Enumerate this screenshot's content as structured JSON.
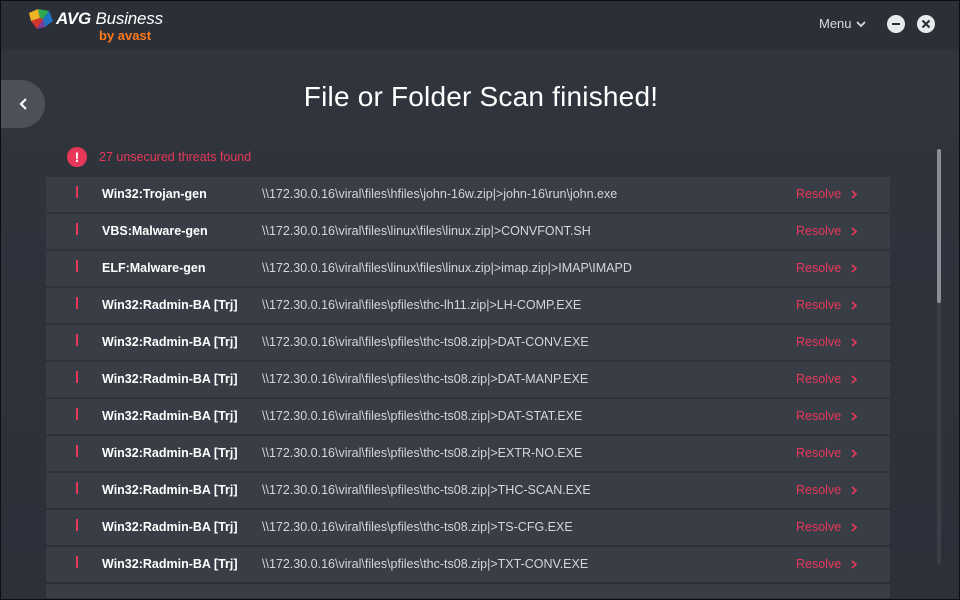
{
  "app": {
    "brand_name": "AVG",
    "brand_suffix": " Business",
    "brand_sub": "by avast",
    "menu_label": "Menu"
  },
  "page": {
    "title": "File or Folder Scan finished!",
    "alert_text": "27 unsecured threats found",
    "alert_glyph": "!",
    "resolve_label": "Resolve"
  },
  "threats": [
    {
      "name": "Win32:Trojan-gen",
      "path": "\\\\172.30.0.16\\viral\\files\\hfiles\\john-16w.zip|>john-16\\run\\john.exe"
    },
    {
      "name": "VBS:Malware-gen",
      "path": "\\\\172.30.0.16\\viral\\files\\linux\\files\\linux.zip|>CONVFONT.SH"
    },
    {
      "name": "ELF:Malware-gen",
      "path": "\\\\172.30.0.16\\viral\\files\\linux\\files\\linux.zip|>imap.zip|>IMAP\\IMAPD"
    },
    {
      "name": "Win32:Radmin-BA [Trj]",
      "path": "\\\\172.30.0.16\\viral\\files\\pfiles\\thc-lh11.zip|>LH-COMP.EXE"
    },
    {
      "name": "Win32:Radmin-BA [Trj]",
      "path": "\\\\172.30.0.16\\viral\\files\\pfiles\\thc-ts08.zip|>DAT-CONV.EXE"
    },
    {
      "name": "Win32:Radmin-BA [Trj]",
      "path": "\\\\172.30.0.16\\viral\\files\\pfiles\\thc-ts08.zip|>DAT-MANP.EXE"
    },
    {
      "name": "Win32:Radmin-BA [Trj]",
      "path": "\\\\172.30.0.16\\viral\\files\\pfiles\\thc-ts08.zip|>DAT-STAT.EXE"
    },
    {
      "name": "Win32:Radmin-BA [Trj]",
      "path": "\\\\172.30.0.16\\viral\\files\\pfiles\\thc-ts08.zip|>EXTR-NO.EXE"
    },
    {
      "name": "Win32:Radmin-BA [Trj]",
      "path": "\\\\172.30.0.16\\viral\\files\\pfiles\\thc-ts08.zip|>THC-SCAN.EXE"
    },
    {
      "name": "Win32:Radmin-BA [Trj]",
      "path": "\\\\172.30.0.16\\viral\\files\\pfiles\\thc-ts08.zip|>TS-CFG.EXE"
    },
    {
      "name": "Win32:Radmin-BA [Trj]",
      "path": "\\\\172.30.0.16\\viral\\files\\pfiles\\thc-ts08.zip|>TXT-CONV.EXE"
    }
  ],
  "colors": {
    "accent_red": "#e8385a",
    "brand_orange": "#ff7a1a",
    "row_bg": "#393d46",
    "window_bg": "#2c3039"
  },
  "icons": {
    "logo": "avg-logo-icon",
    "menu_chevron": "chevron-down-icon",
    "minimize": "minimize-icon",
    "close": "close-icon",
    "back": "chevron-left-icon",
    "alert": "alert-icon",
    "threat_marker": "exclamation-icon",
    "resolve_chevron": "chevron-right-icon"
  }
}
